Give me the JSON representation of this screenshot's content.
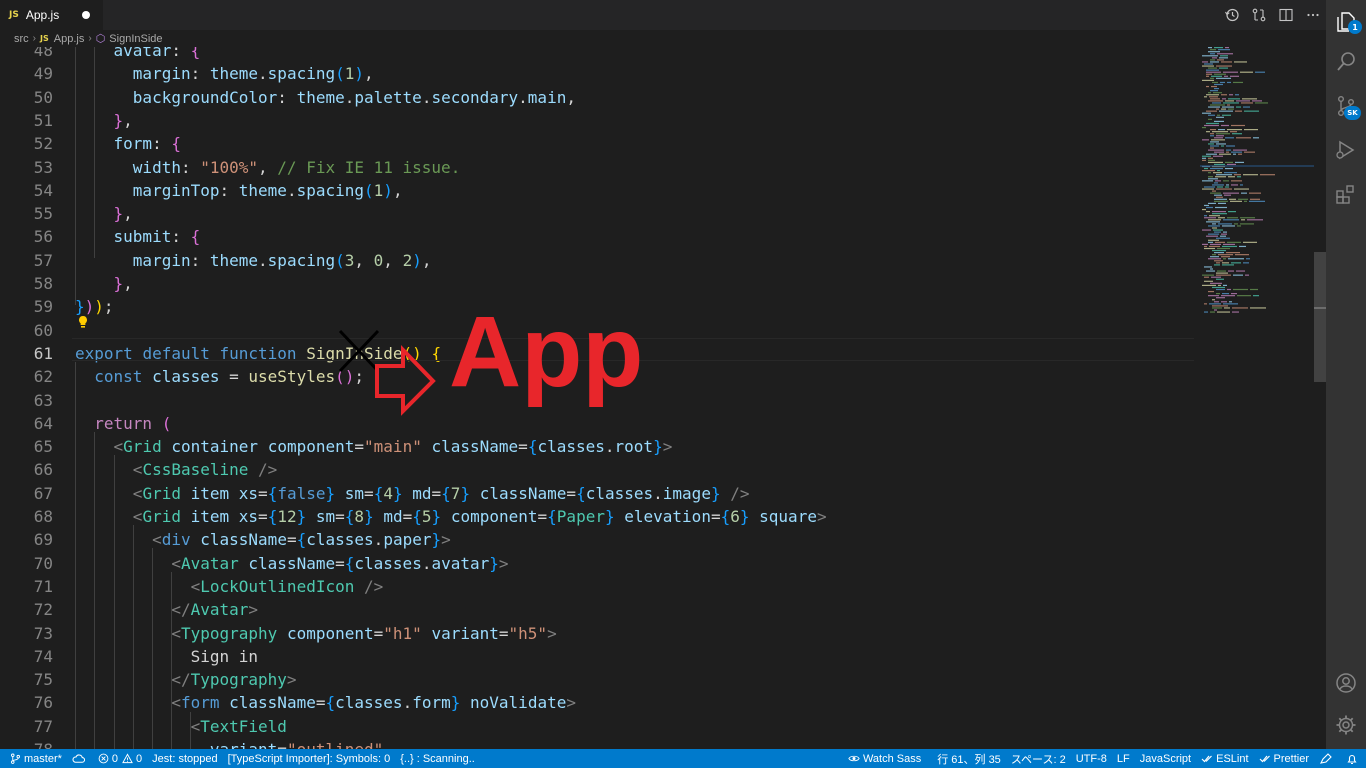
{
  "tab": {
    "badge": "JS",
    "filename": "App.js"
  },
  "breadcrumb": {
    "folder": "src",
    "file_badge": "JS",
    "file": "App.js",
    "symbol": "SignInSide"
  },
  "editor": {
    "lines": [
      {
        "n": "48",
        "tokens": [
          [
            "pun",
            "    "
          ],
          [
            "prop",
            "avatar"
          ],
          [
            "pun",
            ": "
          ],
          [
            "br2",
            "{"
          ]
        ]
      },
      {
        "n": "49",
        "tokens": [
          [
            "pun",
            "      "
          ],
          [
            "prop",
            "margin"
          ],
          [
            "pun",
            ": "
          ],
          [
            "var",
            "theme"
          ],
          [
            "pun",
            "."
          ],
          [
            "var",
            "spacing"
          ],
          [
            "br3",
            "("
          ],
          [
            "num",
            "1"
          ],
          [
            "br3",
            ")"
          ],
          [
            "pun",
            ","
          ]
        ]
      },
      {
        "n": "50",
        "tokens": [
          [
            "pun",
            "      "
          ],
          [
            "prop",
            "backgroundColor"
          ],
          [
            "pun",
            ": "
          ],
          [
            "var",
            "theme"
          ],
          [
            "pun",
            "."
          ],
          [
            "var",
            "palette"
          ],
          [
            "pun",
            "."
          ],
          [
            "var",
            "secondary"
          ],
          [
            "pun",
            "."
          ],
          [
            "var",
            "main"
          ],
          [
            "pun",
            ","
          ]
        ]
      },
      {
        "n": "51",
        "tokens": [
          [
            "pun",
            "    "
          ],
          [
            "br2",
            "}"
          ],
          [
            "pun",
            ","
          ]
        ]
      },
      {
        "n": "52",
        "tokens": [
          [
            "pun",
            "    "
          ],
          [
            "prop",
            "form"
          ],
          [
            "pun",
            ": "
          ],
          [
            "br2",
            "{"
          ]
        ]
      },
      {
        "n": "53",
        "tokens": [
          [
            "pun",
            "      "
          ],
          [
            "prop",
            "width"
          ],
          [
            "pun",
            ": "
          ],
          [
            "str",
            "\"100%\""
          ],
          [
            "pun",
            ", "
          ],
          [
            "com",
            "// Fix IE 11 issue."
          ]
        ]
      },
      {
        "n": "54",
        "tokens": [
          [
            "pun",
            "      "
          ],
          [
            "prop",
            "marginTop"
          ],
          [
            "pun",
            ": "
          ],
          [
            "var",
            "theme"
          ],
          [
            "pun",
            "."
          ],
          [
            "var",
            "spacing"
          ],
          [
            "br3",
            "("
          ],
          [
            "num",
            "1"
          ],
          [
            "br3",
            ")"
          ],
          [
            "pun",
            ","
          ]
        ]
      },
      {
        "n": "55",
        "tokens": [
          [
            "pun",
            "    "
          ],
          [
            "br2",
            "}"
          ],
          [
            "pun",
            ","
          ]
        ]
      },
      {
        "n": "56",
        "tokens": [
          [
            "pun",
            "    "
          ],
          [
            "prop",
            "submit"
          ],
          [
            "pun",
            ": "
          ],
          [
            "br2",
            "{"
          ]
        ]
      },
      {
        "n": "57",
        "tokens": [
          [
            "pun",
            "      "
          ],
          [
            "prop",
            "margin"
          ],
          [
            "pun",
            ": "
          ],
          [
            "var",
            "theme"
          ],
          [
            "pun",
            "."
          ],
          [
            "var",
            "spacing"
          ],
          [
            "br3",
            "("
          ],
          [
            "num",
            "3"
          ],
          [
            "pun",
            ", "
          ],
          [
            "num",
            "0"
          ],
          [
            "pun",
            ", "
          ],
          [
            "num",
            "2"
          ],
          [
            "br3",
            ")"
          ],
          [
            "pun",
            ","
          ]
        ]
      },
      {
        "n": "58",
        "tokens": [
          [
            "pun",
            "    "
          ],
          [
            "br2",
            "}"
          ],
          [
            "pun",
            ","
          ]
        ]
      },
      {
        "n": "59",
        "tokens": [
          [
            "br3",
            "}"
          ],
          [
            "br2",
            ")"
          ],
          [
            "br1",
            ")"
          ],
          [
            "pun",
            ";"
          ]
        ]
      },
      {
        "n": "60",
        "tokens": []
      },
      {
        "n": "61",
        "tokens": [
          [
            "kw",
            "export "
          ],
          [
            "kw",
            "default "
          ],
          [
            "kw",
            "function "
          ],
          [
            "fn",
            "SignInSide"
          ],
          [
            "br1",
            "()"
          ],
          [
            "pun",
            " "
          ],
          [
            "br1",
            "{"
          ]
        ]
      },
      {
        "n": "62",
        "tokens": [
          [
            "pun",
            "  "
          ],
          [
            "kw",
            "const "
          ],
          [
            "var",
            "classes"
          ],
          [
            "pun",
            " = "
          ],
          [
            "fn",
            "useStyles"
          ],
          [
            "br2",
            "()"
          ],
          [
            "pun",
            ";"
          ]
        ]
      },
      {
        "n": "63",
        "tokens": []
      },
      {
        "n": "64",
        "tokens": [
          [
            "pun",
            "  "
          ],
          [
            "ctrl",
            "return "
          ],
          [
            "br2",
            "("
          ]
        ]
      },
      {
        "n": "65",
        "tokens": [
          [
            "pun",
            "    "
          ],
          [
            "tagp",
            "<"
          ],
          [
            "tag",
            "Grid"
          ],
          [
            "pun",
            " "
          ],
          [
            "attr",
            "container"
          ],
          [
            "pun",
            " "
          ],
          [
            "attr",
            "component"
          ],
          [
            "pun",
            "="
          ],
          [
            "str",
            "\"main\""
          ],
          [
            "pun",
            " "
          ],
          [
            "attr",
            "className"
          ],
          [
            "pun",
            "="
          ],
          [
            "br3",
            "{"
          ],
          [
            "var",
            "classes"
          ],
          [
            "pun",
            "."
          ],
          [
            "var",
            "root"
          ],
          [
            "br3",
            "}"
          ],
          [
            "tagp",
            ">"
          ]
        ]
      },
      {
        "n": "66",
        "tokens": [
          [
            "pun",
            "      "
          ],
          [
            "tagp",
            "<"
          ],
          [
            "tag",
            "CssBaseline"
          ],
          [
            "pun",
            " "
          ],
          [
            "tagp",
            "/>"
          ]
        ]
      },
      {
        "n": "67",
        "tokens": [
          [
            "pun",
            "      "
          ],
          [
            "tagp",
            "<"
          ],
          [
            "tag",
            "Grid"
          ],
          [
            "pun",
            " "
          ],
          [
            "attr",
            "item"
          ],
          [
            "pun",
            " "
          ],
          [
            "attr",
            "xs"
          ],
          [
            "pun",
            "="
          ],
          [
            "br3",
            "{"
          ],
          [
            "kw",
            "false"
          ],
          [
            "br3",
            "}"
          ],
          [
            "pun",
            " "
          ],
          [
            "attr",
            "sm"
          ],
          [
            "pun",
            "="
          ],
          [
            "br3",
            "{"
          ],
          [
            "num",
            "4"
          ],
          [
            "br3",
            "}"
          ],
          [
            "pun",
            " "
          ],
          [
            "attr",
            "md"
          ],
          [
            "pun",
            "="
          ],
          [
            "br3",
            "{"
          ],
          [
            "num",
            "7"
          ],
          [
            "br3",
            "}"
          ],
          [
            "pun",
            " "
          ],
          [
            "attr",
            "className"
          ],
          [
            "pun",
            "="
          ],
          [
            "br3",
            "{"
          ],
          [
            "var",
            "classes"
          ],
          [
            "pun",
            "."
          ],
          [
            "var",
            "image"
          ],
          [
            "br3",
            "}"
          ],
          [
            "pun",
            " "
          ],
          [
            "tagp",
            "/>"
          ]
        ]
      },
      {
        "n": "68",
        "tokens": [
          [
            "pun",
            "      "
          ],
          [
            "tagp",
            "<"
          ],
          [
            "tag",
            "Grid"
          ],
          [
            "pun",
            " "
          ],
          [
            "attr",
            "item"
          ],
          [
            "pun",
            " "
          ],
          [
            "attr",
            "xs"
          ],
          [
            "pun",
            "="
          ],
          [
            "br3",
            "{"
          ],
          [
            "num",
            "12"
          ],
          [
            "br3",
            "}"
          ],
          [
            "pun",
            " "
          ],
          [
            "attr",
            "sm"
          ],
          [
            "pun",
            "="
          ],
          [
            "br3",
            "{"
          ],
          [
            "num",
            "8"
          ],
          [
            "br3",
            "}"
          ],
          [
            "pun",
            " "
          ],
          [
            "attr",
            "md"
          ],
          [
            "pun",
            "="
          ],
          [
            "br3",
            "{"
          ],
          [
            "num",
            "5"
          ],
          [
            "br3",
            "}"
          ],
          [
            "pun",
            " "
          ],
          [
            "attr",
            "component"
          ],
          [
            "pun",
            "="
          ],
          [
            "br3",
            "{"
          ],
          [
            "tag",
            "Paper"
          ],
          [
            "br3",
            "}"
          ],
          [
            "pun",
            " "
          ],
          [
            "attr",
            "elevation"
          ],
          [
            "pun",
            "="
          ],
          [
            "br3",
            "{"
          ],
          [
            "num",
            "6"
          ],
          [
            "br3",
            "}"
          ],
          [
            "pun",
            " "
          ],
          [
            "attr",
            "square"
          ],
          [
            "tagp",
            ">"
          ]
        ]
      },
      {
        "n": "69",
        "tokens": [
          [
            "pun",
            "        "
          ],
          [
            "tagp",
            "<"
          ],
          [
            "kw",
            "div"
          ],
          [
            "pun",
            " "
          ],
          [
            "attr",
            "className"
          ],
          [
            "pun",
            "="
          ],
          [
            "br3",
            "{"
          ],
          [
            "var",
            "classes"
          ],
          [
            "pun",
            "."
          ],
          [
            "var",
            "paper"
          ],
          [
            "br3",
            "}"
          ],
          [
            "tagp",
            ">"
          ]
        ]
      },
      {
        "n": "70",
        "tokens": [
          [
            "pun",
            "          "
          ],
          [
            "tagp",
            "<"
          ],
          [
            "tag",
            "Avatar"
          ],
          [
            "pun",
            " "
          ],
          [
            "attr",
            "className"
          ],
          [
            "pun",
            "="
          ],
          [
            "br3",
            "{"
          ],
          [
            "var",
            "classes"
          ],
          [
            "pun",
            "."
          ],
          [
            "var",
            "avatar"
          ],
          [
            "br3",
            "}"
          ],
          [
            "tagp",
            ">"
          ]
        ]
      },
      {
        "n": "71",
        "tokens": [
          [
            "pun",
            "            "
          ],
          [
            "tagp",
            "<"
          ],
          [
            "tag",
            "LockOutlinedIcon"
          ],
          [
            "pun",
            " "
          ],
          [
            "tagp",
            "/>"
          ]
        ]
      },
      {
        "n": "72",
        "tokens": [
          [
            "pun",
            "          "
          ],
          [
            "tagp",
            "</"
          ],
          [
            "tag",
            "Avatar"
          ],
          [
            "tagp",
            ">"
          ]
        ]
      },
      {
        "n": "73",
        "tokens": [
          [
            "pun",
            "          "
          ],
          [
            "tagp",
            "<"
          ],
          [
            "tag",
            "Typography"
          ],
          [
            "pun",
            " "
          ],
          [
            "attr",
            "component"
          ],
          [
            "pun",
            "="
          ],
          [
            "str",
            "\"h1\""
          ],
          [
            "pun",
            " "
          ],
          [
            "attr",
            "variant"
          ],
          [
            "pun",
            "="
          ],
          [
            "str",
            "\"h5\""
          ],
          [
            "tagp",
            ">"
          ]
        ]
      },
      {
        "n": "74",
        "tokens": [
          [
            "pun",
            "            "
          ],
          [
            "txt",
            "Sign in"
          ]
        ]
      },
      {
        "n": "75",
        "tokens": [
          [
            "pun",
            "          "
          ],
          [
            "tagp",
            "</"
          ],
          [
            "tag",
            "Typography"
          ],
          [
            "tagp",
            ">"
          ]
        ]
      },
      {
        "n": "76",
        "tokens": [
          [
            "pun",
            "          "
          ],
          [
            "tagp",
            "<"
          ],
          [
            "kw",
            "form"
          ],
          [
            "pun",
            " "
          ],
          [
            "attr",
            "className"
          ],
          [
            "pun",
            "="
          ],
          [
            "br3",
            "{"
          ],
          [
            "var",
            "classes"
          ],
          [
            "pun",
            "."
          ],
          [
            "var",
            "form"
          ],
          [
            "br3",
            "}"
          ],
          [
            "pun",
            " "
          ],
          [
            "attr",
            "noValidate"
          ],
          [
            "tagp",
            ">"
          ]
        ]
      },
      {
        "n": "77",
        "tokens": [
          [
            "pun",
            "            "
          ],
          [
            "tagp",
            "<"
          ],
          [
            "tag",
            "TextField"
          ]
        ]
      },
      {
        "n": "78",
        "tokens": [
          [
            "pun",
            "              "
          ],
          [
            "attr",
            "variant"
          ],
          [
            "pun",
            "="
          ],
          [
            "str",
            "\"outlined\""
          ]
        ]
      }
    ],
    "active_line": "61"
  },
  "annotation": {
    "text": "App",
    "color": "#e8262b"
  },
  "activity_bar": {
    "explorer_badge": "1",
    "scm_badge": "SK",
    "items": [
      "files-icon",
      "search-icon",
      "source-control-icon",
      "run-debug-icon",
      "extensions-icon",
      "account-icon",
      "settings-gear-icon"
    ]
  },
  "statusbar": {
    "branch": "master*",
    "problems_errors": "0",
    "problems_warnings": "0",
    "jest": "Jest: stopped",
    "ts_importer": "[TypeScript Importer]: Symbols: 0",
    "scanning": "{..} : Scanning..",
    "watch_sass": "Watch Sass",
    "cursor": "行 61、列 35",
    "indent": "スペース: 2",
    "encoding": "UTF-8",
    "eol": "LF",
    "language": "JavaScript",
    "eslint": "ESLint",
    "prettier": "Prettier"
  },
  "colors": {
    "accent": "#007acc",
    "activity_bg": "#333333",
    "editor_bg": "#1e1e1e",
    "tabbar_bg": "#252526"
  }
}
